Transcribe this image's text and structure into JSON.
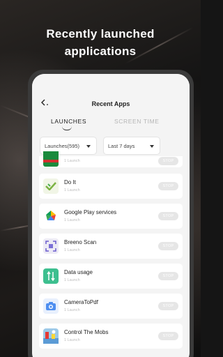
{
  "headline": {
    "line1": "Recently launched",
    "line2": "applications"
  },
  "screen": {
    "title": "Recent Apps",
    "tabs": [
      {
        "label": "LAUNCHES",
        "active": true
      },
      {
        "label": "SCREEN TIME",
        "active": false
      }
    ],
    "filters": {
      "metric": "Launches(595)",
      "range": "Last 7 days"
    }
  },
  "apps": [
    {
      "name": "",
      "sub": "1 Launch",
      "stop": "STOP",
      "icon": "oppo-store-icon"
    },
    {
      "name": "Do It",
      "sub": "1 Launch",
      "stop": "STOP",
      "icon": "do-it-icon"
    },
    {
      "name": "Google Play services",
      "sub": "1 Launch",
      "stop": "STOP",
      "icon": "google-play-services-icon"
    },
    {
      "name": "Breeno Scan",
      "sub": "1 Launch",
      "stop": "STOP",
      "icon": "breeno-scan-icon"
    },
    {
      "name": "Data usage",
      "sub": "1 Launch",
      "stop": "STOP",
      "icon": "data-usage-icon"
    },
    {
      "name": "CameraToPdf",
      "sub": "1 Launch",
      "stop": "STOP",
      "icon": "camera-to-pdf-icon"
    },
    {
      "name": "Control The Mobs",
      "sub": "1 Launch",
      "stop": "STOP",
      "icon": "control-the-mobs-icon"
    }
  ],
  "colors": {
    "accent": "#4f8ff0",
    "stop_bg": "#e6e6e6"
  }
}
